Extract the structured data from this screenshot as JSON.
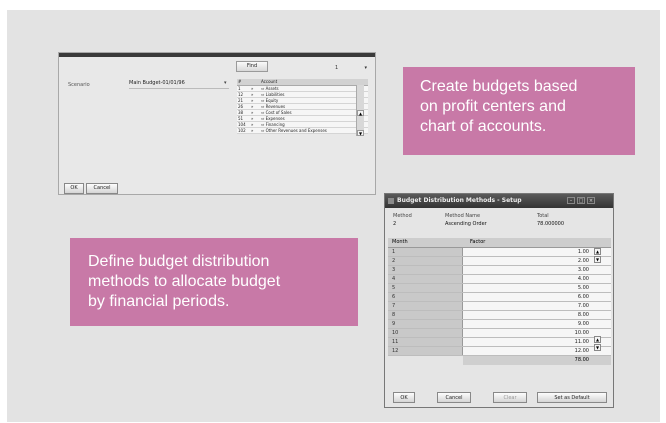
{
  "window1": {
    "find_label": "Find",
    "find_select_value": "1",
    "find_select_arrow": "▾",
    "scenario_label": "Scenario",
    "scenario_value": "Main Budget-01/01/96",
    "scenario_arrow": "▾",
    "accounts_headers": [
      "#",
      "",
      "Account"
    ],
    "accounts": [
      {
        "no": "1",
        "mark": "»",
        "name": "⇨ Assets"
      },
      {
        "no": "12",
        "mark": "»",
        "name": "⇨ Liabilities"
      },
      {
        "no": "21",
        "mark": "»",
        "name": "⇨ Equity"
      },
      {
        "no": "26",
        "mark": "»",
        "name": "⇨ Revenues"
      },
      {
        "no": "38",
        "mark": "»",
        "name": "⇨ Cost of Sales"
      },
      {
        "no": "51",
        "mark": "»",
        "name": "⇨ Expenses"
      },
      {
        "no": "104",
        "mark": "»",
        "name": "⇨ Financing"
      },
      {
        "no": "102",
        "mark": "»",
        "name": "⇨ Other Revenues and Expenses"
      }
    ],
    "ok_label": "OK",
    "cancel_label": "Cancel"
  },
  "callout1": {
    "lines": [
      "Create budgets based",
      "on profit centers and",
      "chart of accounts."
    ],
    "color": "#c879a7"
  },
  "callout2": {
    "lines": [
      "Define budget distribution",
      "methods to allocate budget",
      "by financial periods."
    ],
    "color": "#c879a7"
  },
  "window2": {
    "title": "Budget Distribution Methods - Setup",
    "method_label": "Method",
    "method_value": "2",
    "method_name_label": "Method Name",
    "method_name_value": "Ascending Order",
    "total_label": "Total",
    "total_value": "78.000000",
    "grid_headers": {
      "month": "Month",
      "factor": "Factor"
    },
    "rows": [
      {
        "month": "1",
        "factor": "1.00"
      },
      {
        "month": "2",
        "factor": "2.00"
      },
      {
        "month": "3",
        "factor": "3.00"
      },
      {
        "month": "4",
        "factor": "4.00"
      },
      {
        "month": "5",
        "factor": "5.00"
      },
      {
        "month": "6",
        "factor": "6.00"
      },
      {
        "month": "7",
        "factor": "7.00"
      },
      {
        "month": "8",
        "factor": "8.00"
      },
      {
        "month": "9",
        "factor": "9.00"
      },
      {
        "month": "10",
        "factor": "10.00"
      },
      {
        "month": "11",
        "factor": "11.00"
      },
      {
        "month": "12",
        "factor": "12.00"
      }
    ],
    "grid_total": "78.00",
    "ok_label": "OK",
    "cancel_label": "Cancel",
    "clear_label": "Clear",
    "default_label": "Set as Default"
  }
}
